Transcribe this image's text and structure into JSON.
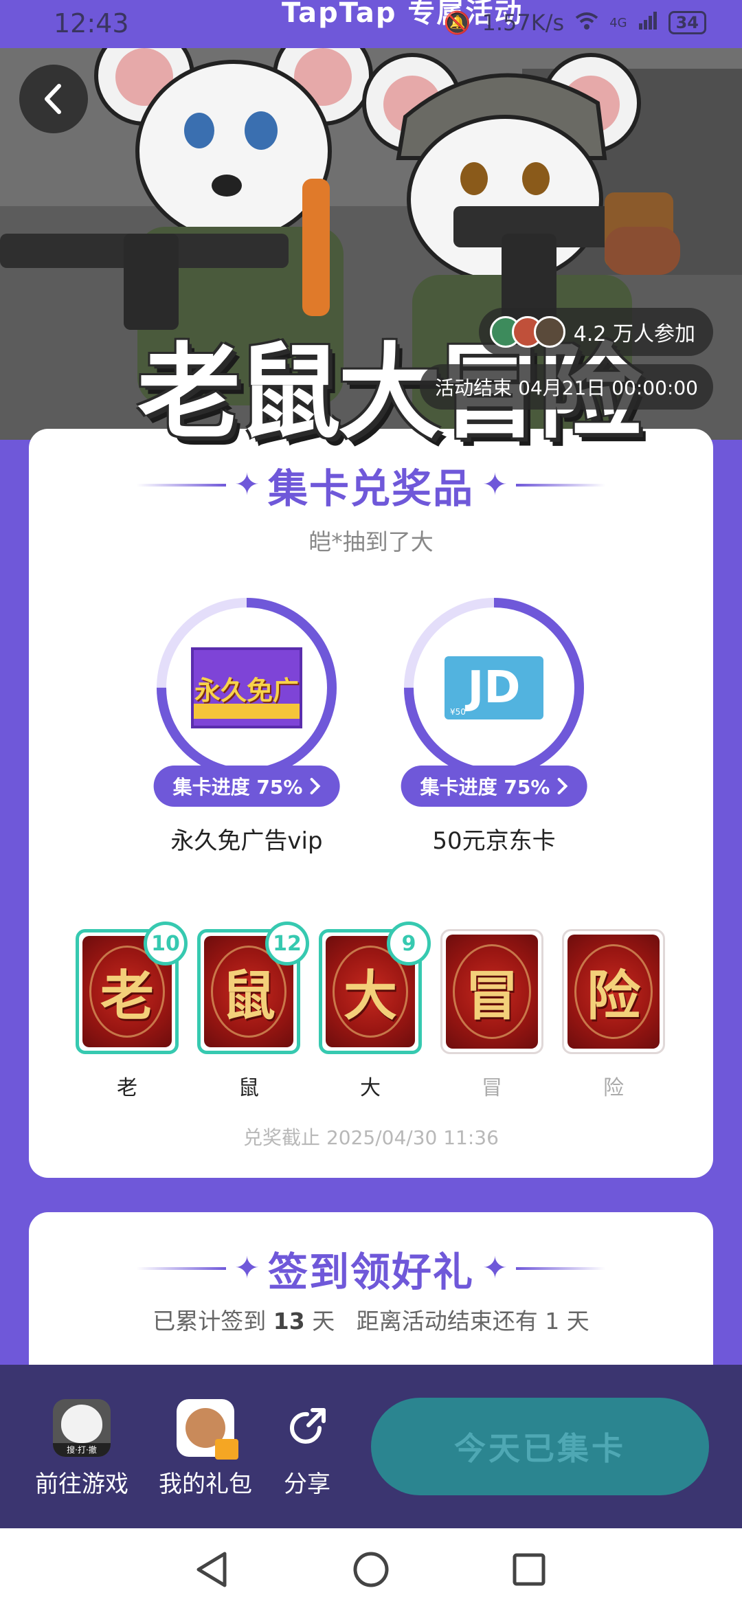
{
  "status_bar": {
    "time": "12:43",
    "title": "TapTap 专属活动",
    "speed": "1.57K/s",
    "network": "4G",
    "battery": "34"
  },
  "hero": {
    "game_title": "老鼠大冒险",
    "participants": "4.2 万人参加",
    "end_time": "活动结束 04月21日 00:00:00"
  },
  "collect": {
    "title": "集卡兑奖品",
    "subtitle": "皑*抽到了大",
    "prizes": [
      {
        "name": "永久免广告vip",
        "image_text": "永久免广",
        "progress_label": "集卡进度 75%",
        "progress": 0.75
      },
      {
        "name": "50元京东卡",
        "image_text": "JD",
        "image_small": "¥50",
        "progress_label": "集卡进度 75%",
        "progress": 0.75
      }
    ],
    "cards": [
      {
        "char": "老",
        "label": "老",
        "count": "10",
        "owned": true
      },
      {
        "char": "鼠",
        "label": "鼠",
        "count": "12",
        "owned": true
      },
      {
        "char": "大",
        "label": "大",
        "count": "9",
        "owned": true
      },
      {
        "char": "冒",
        "label": "冒",
        "count": "",
        "owned": false
      },
      {
        "char": "险",
        "label": "险",
        "count": "",
        "owned": false
      }
    ],
    "deadline": "兑奖截止 2025/04/30 11:36"
  },
  "signin": {
    "title": "签到领好礼",
    "prefix": "已累计签到",
    "days": "13",
    "days_unit": "天",
    "remaining": "距离活动结束还有 1 天"
  },
  "actions": {
    "game": "前往游戏",
    "game_icon_text": "搜·打·撤",
    "gifts": "我的礼包",
    "share": "分享",
    "main_button": "今天已集卡"
  },
  "colors": {
    "accent": "#6f58d9",
    "teal": "#36c9b0",
    "bar": "#3b3570",
    "button": "#2b8590"
  }
}
